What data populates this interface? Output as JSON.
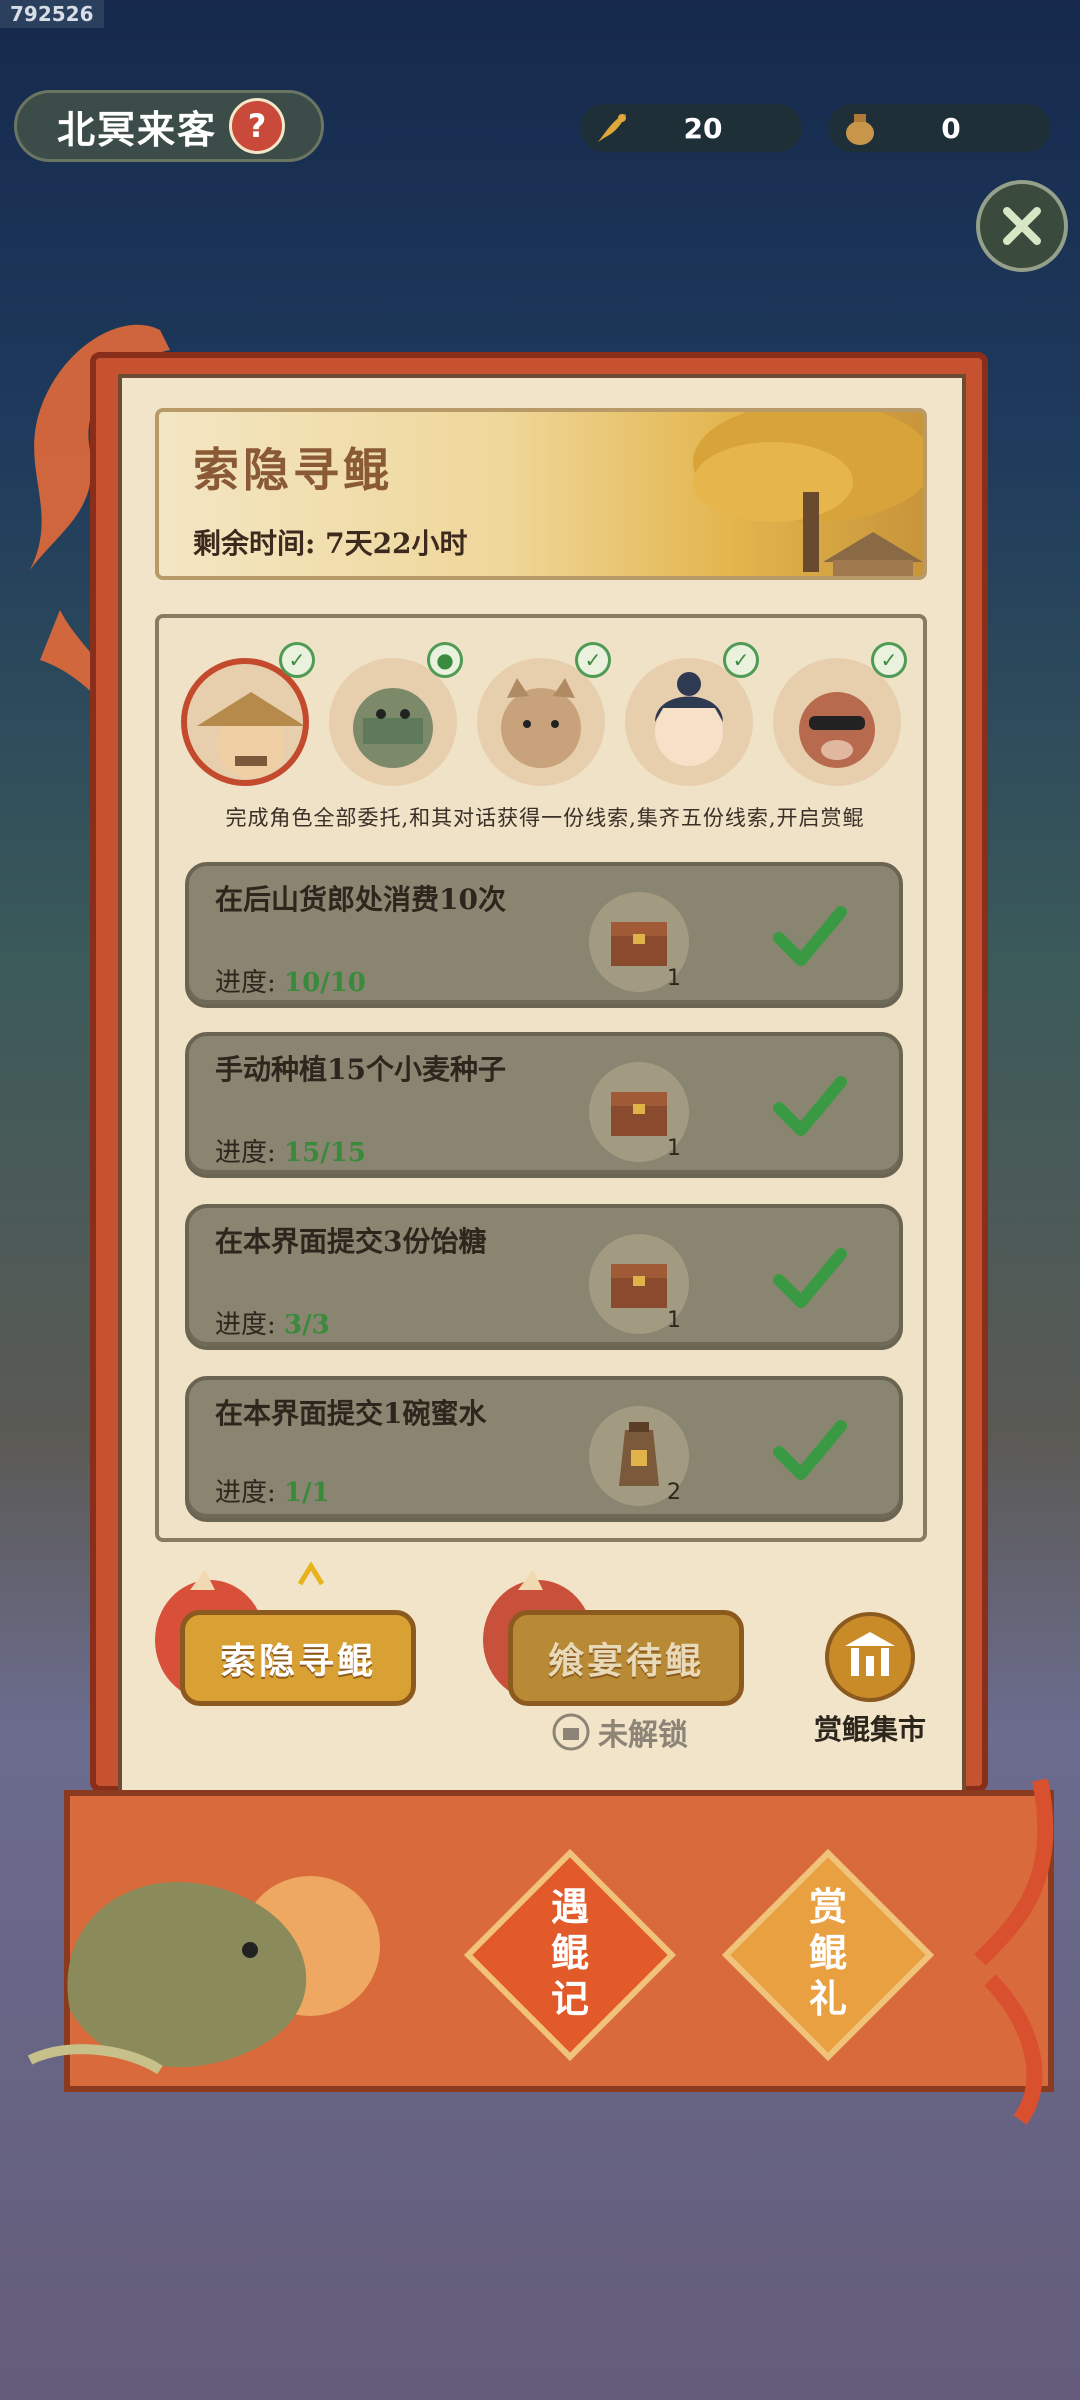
{
  "stamp": "792526",
  "header": {
    "title": "北冥来客",
    "help_icon": "?",
    "resources": [
      {
        "icon": "feather-icon",
        "value": "20"
      },
      {
        "icon": "money-bag-icon",
        "value": "0"
      }
    ]
  },
  "banner": {
    "title": "索隐寻鲲",
    "time_label": "剩余时间: 7天22小时"
  },
  "characters": [
    {
      "name": "straw-hat-elder",
      "done": true
    },
    {
      "name": "masked-ninja",
      "done": true
    },
    {
      "name": "cat-scholar",
      "done": true
    },
    {
      "name": "girl-attendant",
      "done": true
    },
    {
      "name": "boar-with-sunglasses",
      "done": true
    }
  ],
  "hint": "完成角色全部委托,和其对话获得一份线索,集齐五份线索,开启赏鲲",
  "tasks": [
    {
      "title": "在后山货郎处消费10次",
      "progress_label": "进度:",
      "progress": "10/10",
      "reward_count": "1"
    },
    {
      "title": "手动种植15个小麦种子",
      "progress_label": "进度:",
      "progress": "15/15",
      "reward_count": "1"
    },
    {
      "title": "在本界面提交3份饴糖",
      "progress_label": "进度:",
      "progress": "3/3",
      "reward_count": "1"
    },
    {
      "title": "在本界面提交1碗蜜水",
      "progress_label": "进度:",
      "progress": "1/1",
      "reward_count": "2"
    }
  ],
  "buttons": {
    "search": "索隐寻鲲",
    "feast": "飨宴待鲲",
    "locked": "未解锁",
    "market": "赏鲲集市"
  },
  "bottom": {
    "record": "遇鲲记",
    "gift": "赏鲲礼"
  },
  "colors": {
    "accent_red": "#c7522f",
    "check_green": "#3a8a3c",
    "gold": "#d9a033"
  }
}
